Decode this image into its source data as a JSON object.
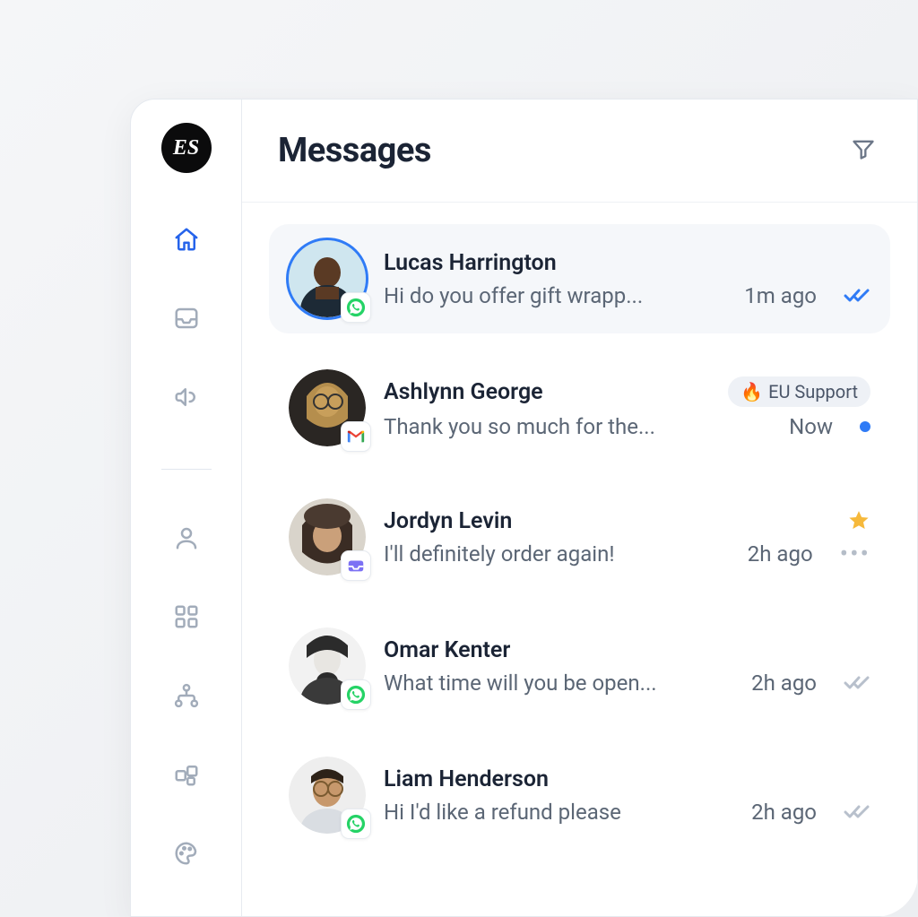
{
  "brand": {
    "monogram": "ES"
  },
  "header": {
    "title": "Messages"
  },
  "sidebar": {
    "items": [
      {
        "name": "home",
        "active": true
      },
      {
        "name": "inbox",
        "active": false
      },
      {
        "name": "campaign",
        "active": false
      },
      {
        "name": "contacts",
        "active": false
      },
      {
        "name": "apps",
        "active": false
      },
      {
        "name": "org",
        "active": false
      },
      {
        "name": "plugins",
        "active": false
      },
      {
        "name": "theme",
        "active": false
      }
    ]
  },
  "tags": {
    "eu_support_label": "EU Support",
    "eu_support_emoji": "🔥"
  },
  "conversations": [
    {
      "name": "Lucas Harrington",
      "preview": "Hi do you offer gift wrapp...",
      "time": "1m ago",
      "channel": "whatsapp",
      "selected": true,
      "status": "read-blue"
    },
    {
      "name": "Ashlynn George",
      "preview": "Thank you so much for the...",
      "time": "Now",
      "channel": "gmail",
      "selected": false,
      "tag": "eu_support",
      "status": "unread-dot"
    },
    {
      "name": "Jordyn Levin",
      "preview": "I'll definitely order again!",
      "time": "2h ago",
      "channel": "inbox",
      "selected": false,
      "star": true,
      "status": "more"
    },
    {
      "name": "Omar Kenter",
      "preview": "What time will you be open...",
      "time": "2h ago",
      "channel": "whatsapp",
      "selected": false,
      "status": "delivered-grey"
    },
    {
      "name": "Liam Henderson",
      "preview": "Hi I'd like a refund please",
      "time": "2h ago",
      "channel": "whatsapp",
      "selected": false,
      "status": "delivered-grey"
    }
  ]
}
